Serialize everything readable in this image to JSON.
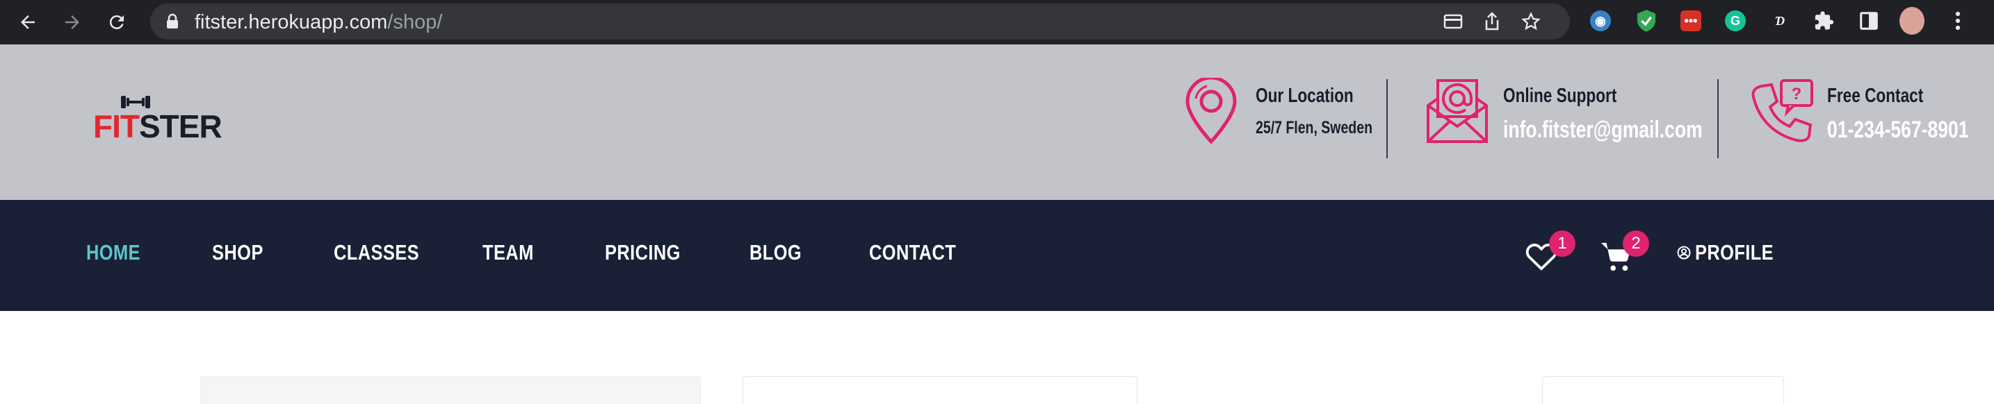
{
  "browser": {
    "url_host": "fitster.herokuapp.com",
    "url_path": "/shop/"
  },
  "brand": {
    "logo_part1": "FIT",
    "logo_part2": "STER"
  },
  "contact": {
    "location_title": "Our Location",
    "location_value": "25/7 Flen, Sweden",
    "support_title": "Online Support",
    "support_value": "info.fitster@gmail.com",
    "phone_title": "Free Contact",
    "phone_value": "01-234-567-8901"
  },
  "nav": {
    "items": [
      {
        "label": "HOME"
      },
      {
        "label": "SHOP"
      },
      {
        "label": "CLASSES"
      },
      {
        "label": "TEAM"
      },
      {
        "label": "PRICING"
      },
      {
        "label": "BLOG"
      },
      {
        "label": "CONTACT"
      }
    ],
    "wishlist_count": "1",
    "cart_count": "2",
    "profile_label": "PROFILE"
  },
  "colors": {
    "accent_pink": "#e0236e",
    "accent_teal": "#5bc8cc",
    "navbar_bg": "#1a2035",
    "header_bg": "#c3c4ca"
  },
  "icons": [
    "back-arrow-icon",
    "forward-arrow-icon",
    "reload-icon",
    "lock-icon",
    "install-icon",
    "share-icon",
    "bookmark-star-icon",
    "location-pin-icon",
    "envelope-icon",
    "phone-icon",
    "heart-icon",
    "cart-icon",
    "profile-icon"
  ]
}
